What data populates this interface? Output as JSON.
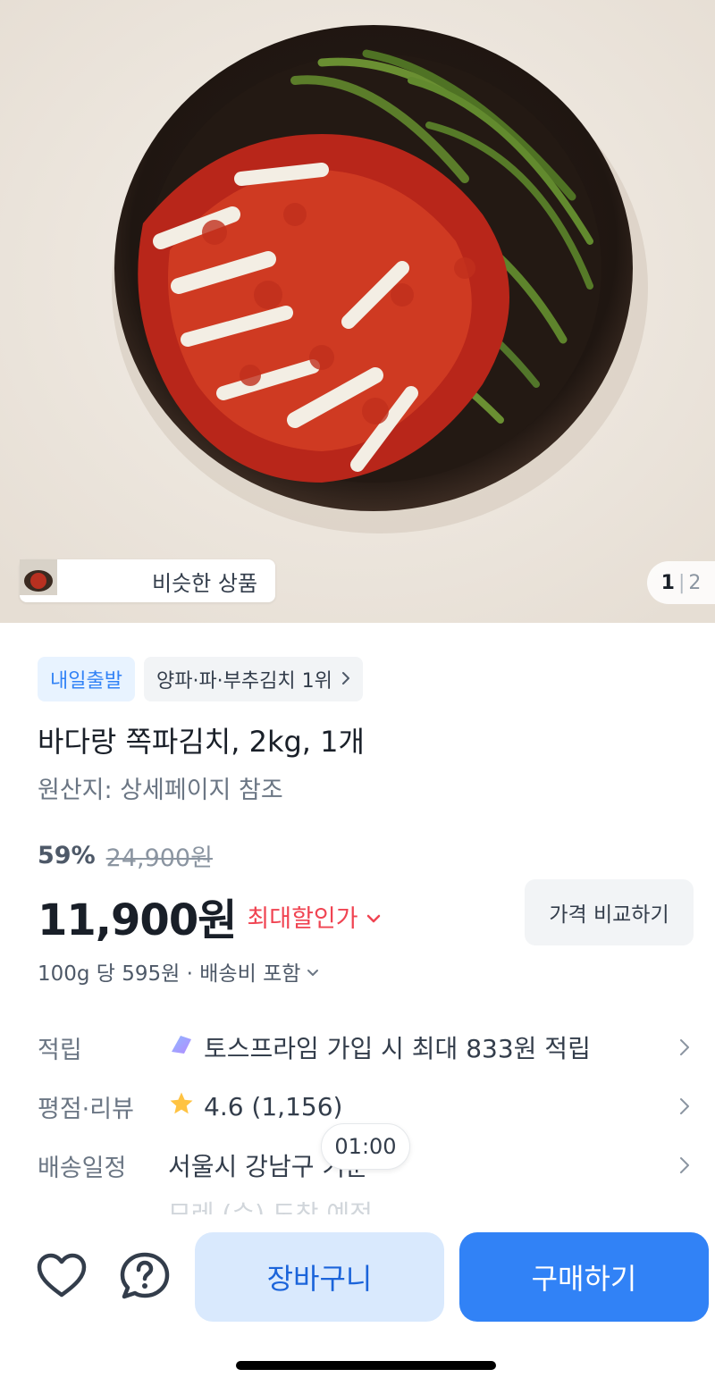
{
  "hero": {
    "image_alt": "쪽파김치",
    "similar_label": "비슷한 상품",
    "page_current": "1",
    "page_sep": "|",
    "page_total": "2"
  },
  "badges": {
    "departure": "내일출발",
    "ranking": "양파·파·부추김치 1위"
  },
  "product": {
    "title": "바다랑 쪽파김치, 2kg, 1개",
    "origin": "원산지: 상세페이지 참조"
  },
  "pricing": {
    "discount_rate": "59%",
    "original_price": "24,900원",
    "price": "11,900원",
    "max_discount_label": "최대할인가",
    "compare_label": "가격 비교하기",
    "unit_price": "100g 당 595원 · 배송비 포함"
  },
  "rows": {
    "points_label": "적립",
    "points_value": "토스프라임 가입 시 최대 833원 적립",
    "rating_label": "평점·리뷰",
    "rating_value": "4.6 (1,156)",
    "delivery_label": "배송일정",
    "delivery_value": "서울시 강남구 기준",
    "delivery_next": "모레 (수) 도착 예정"
  },
  "timer": "01:00",
  "bottom": {
    "cart_label": "장바구니",
    "buy_label": "구매하기"
  },
  "colors": {
    "accent": "#3182f6",
    "accent_light": "#d9e9fd",
    "discount_red": "#f04452",
    "star": "#ffc342"
  },
  "icons": {
    "heart": "heart-icon",
    "question": "question-icon",
    "chevron_right": "chevron-right-icon",
    "chevron_down": "chevron-down-icon",
    "star": "star-icon",
    "toss_prime": "toss-prime-icon"
  }
}
